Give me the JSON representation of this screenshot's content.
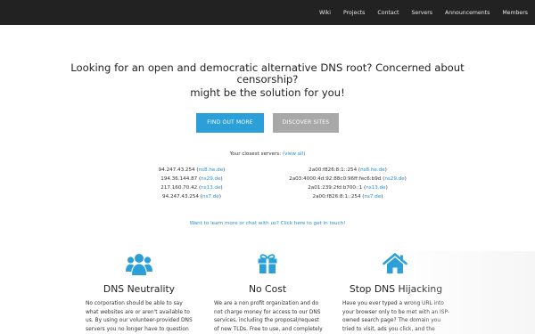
{
  "nav": {
    "items": [
      "Wiki",
      "Projects",
      "Contact",
      "Servers",
      "Announcements",
      "Members"
    ]
  },
  "hero": {
    "line1": "Looking for an open and democratic alternative DNS root? Concerned about",
    "line2": "censorship?",
    "line3": "might be the solution for you!"
  },
  "buttons": {
    "find_out_more": "FIND OUT MORE",
    "discover_sites": "DISCOVER SITES"
  },
  "servers": {
    "heading": "Your closest servers:",
    "view_all": "(view all)",
    "ipv4": [
      {
        "ip": "94.247.43.254",
        "host": "ns8.he.de"
      },
      {
        "ip": "194.36.144.87",
        "host": "ns29.de"
      },
      {
        "ip": "217.160.70.42",
        "host": "ns13.de"
      },
      {
        "ip": "94.247.43.254",
        "host": "ns7.de"
      }
    ],
    "ipv6": [
      {
        "ip": "2a00:f826:8:1::254",
        "host": "ns8.he.de"
      },
      {
        "ip": "2a03:4000:4d:92:88c0:96ff:fec6:b9d",
        "host": "ns29.de"
      },
      {
        "ip": "2a01:239:2fd:b700::1",
        "host": "ns13.de"
      },
      {
        "ip": "2a00:f826:8:1::254",
        "host": "ns7.de"
      }
    ]
  },
  "learn_link": "Want to learn more or chat with us? Click here to get in touch!",
  "features": [
    {
      "icon": "users-icon",
      "title": "DNS Neutrality",
      "lines": [
        "No corporation should be able to say",
        "what websites are or aren't available to",
        "us. By using our volunteer-provided DNS",
        "servers you no longer have to question"
      ]
    },
    {
      "icon": "gift-icon",
      "title": "No Cost",
      "lines": [
        "We are a non profit organization and do",
        "not charge money for access to our DNS",
        "services, including the proposal/request",
        "of new TLDs. Free to use, and completely"
      ]
    },
    {
      "icon": "home-icon",
      "title": "Stop DNS Hijacking",
      "lines": [
        "Have you ever typed a wrong URL into",
        "your browser only to be met with an ISP-",
        "owned search page? The domain you",
        "tried to visit, ads you click, and the"
      ]
    }
  ],
  "colors": {
    "nav_bg": "#222222",
    "accent": "#2a9fd8",
    "button_grey": "#a8a8a8",
    "link": "#2a8fd0"
  }
}
